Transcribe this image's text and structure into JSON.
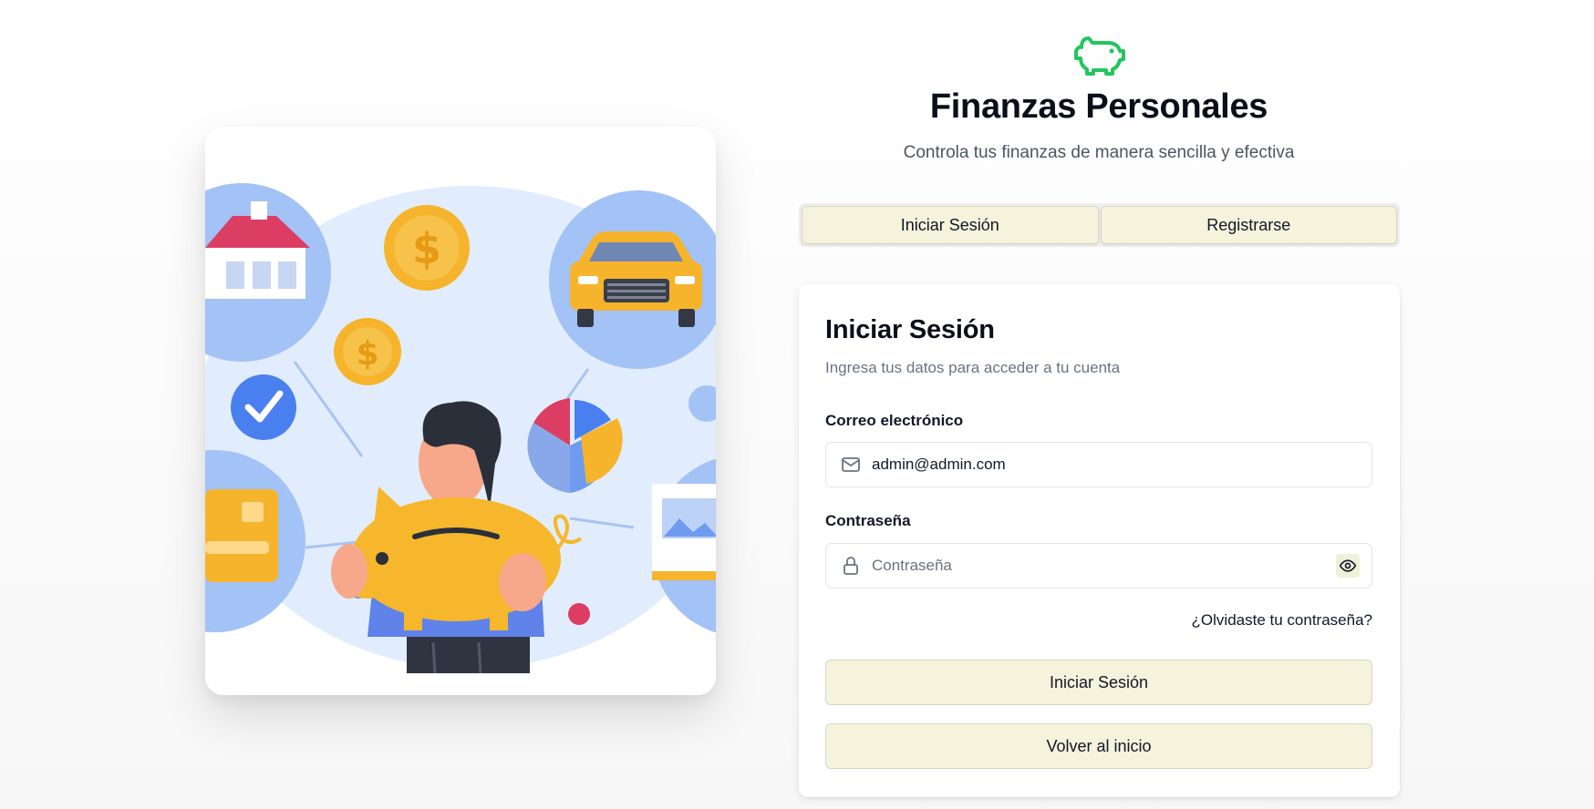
{
  "brand": {
    "icon": "piggy-bank-icon",
    "title": "Finanzas Personales",
    "subtitle": "Controla tus finanzas de manera sencilla y efectiva",
    "accent_color": "#22c55e"
  },
  "tabs": [
    {
      "label": "Iniciar Sesión",
      "active": true
    },
    {
      "label": "Registrarse",
      "active": false
    }
  ],
  "login_card": {
    "title": "Iniciar Sesión",
    "description": "Ingresa tus datos para acceder a tu cuenta",
    "email": {
      "label": "Correo electrónico",
      "value": "admin@admin.com",
      "placeholder": "",
      "icon": "mail-icon"
    },
    "password": {
      "label": "Contraseña",
      "value": "",
      "placeholder": "Contraseña",
      "icon": "lock-icon",
      "toggle_icon": "eye-icon"
    },
    "forgot_link": "¿Olvidaste tu contraseña?",
    "submit_label": "Iniciar Sesión",
    "back_label": "Volver al inicio"
  },
  "colors": {
    "button_bg": "#f5f3dc",
    "illustration_blue": "#a7c4f7",
    "illustration_gold": "#f6b72c"
  }
}
